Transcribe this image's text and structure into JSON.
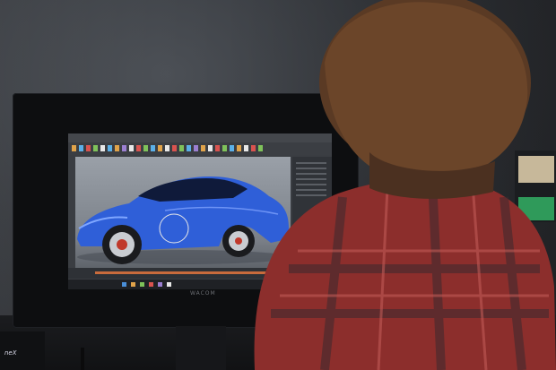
{
  "monitor": {
    "brand": "WACOM"
  },
  "tablet": {
    "label": "neX"
  },
  "screen": {
    "app": "3d-modeling-software",
    "model_color": "#2f5fd8",
    "timeline_range_color": "#c96b3c"
  },
  "colors": {
    "wall": "#35383d",
    "shirt_red": "#8c2e2c",
    "shirt_dark": "#3a2a2e",
    "hair": "#5a3a24"
  }
}
